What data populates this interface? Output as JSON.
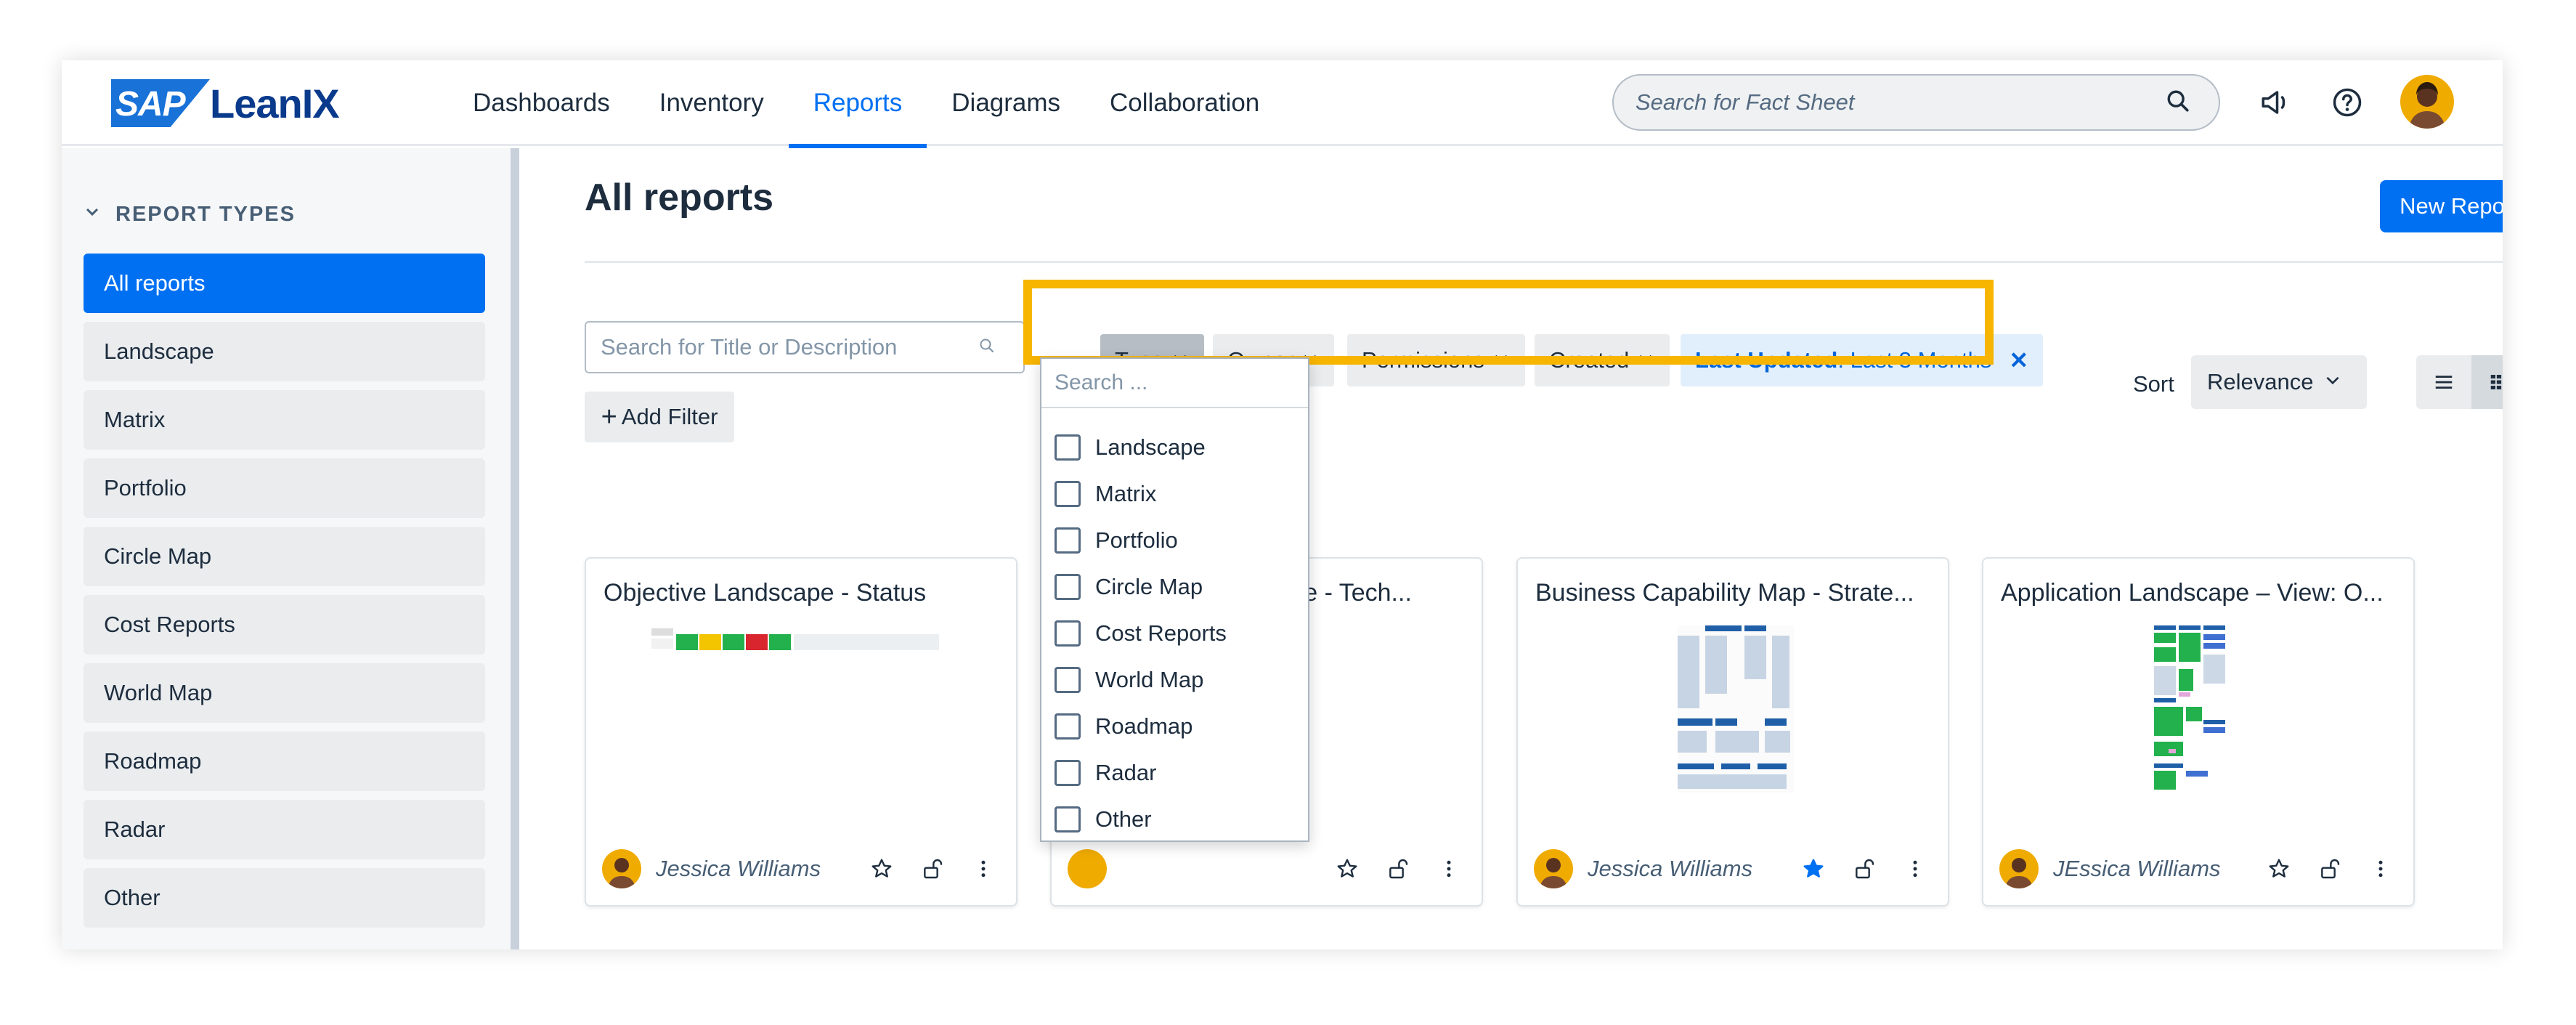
{
  "header": {
    "logo_brand": "SAP",
    "logo_name": "LeanIX",
    "nav": [
      {
        "label": "Dashboards",
        "active": false
      },
      {
        "label": "Inventory",
        "active": false
      },
      {
        "label": "Reports",
        "active": true
      },
      {
        "label": "Diagrams",
        "active": false
      },
      {
        "label": "Collaboration",
        "active": false
      }
    ],
    "search_placeholder": "Search for Fact Sheet",
    "icons": [
      "megaphone-icon",
      "help-icon",
      "user-avatar"
    ]
  },
  "sidebar": {
    "heading": "REPORT TYPES",
    "items": [
      {
        "label": "All reports",
        "active": true
      },
      {
        "label": "Landscape"
      },
      {
        "label": "Matrix"
      },
      {
        "label": "Portfolio"
      },
      {
        "label": "Circle Map"
      },
      {
        "label": "Cost Reports"
      },
      {
        "label": "World Map"
      },
      {
        "label": "Roadmap"
      },
      {
        "label": "Radar"
      },
      {
        "label": "Other"
      }
    ]
  },
  "main": {
    "title": "All reports",
    "new_report_label": "New Report",
    "search_placeholder": "Search for Title or Description",
    "filters": {
      "type": "Type",
      "owner": "Owner",
      "permissions": "Permissions",
      "created": "Created",
      "last_updated_key": "Last Updated",
      "last_updated_value": ": Last 3 Months"
    },
    "add_filter_label": "Add Filter",
    "sort_label": "Sort",
    "sort_value": "Relevance",
    "cards": [
      {
        "title": "Objective Landscape - Status",
        "owner": "Jessica Williams",
        "starred": false
      },
      {
        "title": "Application Landscape - Tech...",
        "visible_title_fragment": "cape - Tech...",
        "owner": "",
        "starred": false
      },
      {
        "title": "Business Capability Map - Strate...",
        "owner": "Jessica Williams",
        "starred": true
      },
      {
        "title": "Application Landscape – View: O...",
        "owner": "JEssica Williams",
        "starred": false
      }
    ]
  },
  "type_dropdown": {
    "search_placeholder": "Search ...",
    "options": [
      "Landscape",
      "Matrix",
      "Portfolio",
      "Circle Map",
      "Cost Reports",
      "World Map",
      "Roadmap",
      "Radar",
      "Other"
    ]
  },
  "colors": {
    "accent": "#0070f2",
    "highlight_box": "#f7b500",
    "sidebar_bg": "#f6f7f8"
  }
}
